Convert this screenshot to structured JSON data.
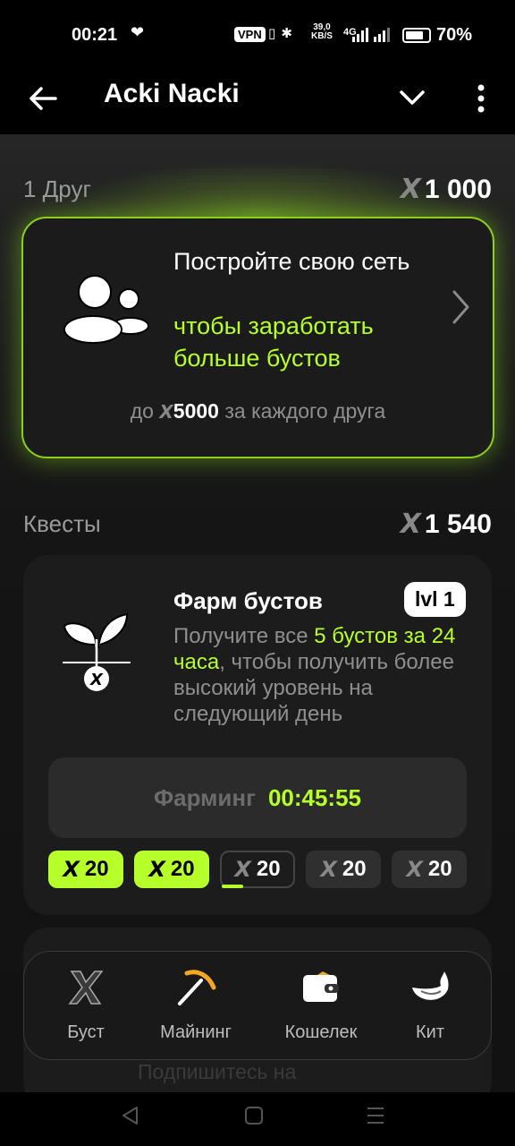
{
  "status_bar": {
    "time": "00:21",
    "vpn": "VPN",
    "net_speed_value": "39,0",
    "net_speed_unit": "KB/S",
    "signal": "4G",
    "battery": "70%"
  },
  "app_bar": {
    "title": "Acki Nacki"
  },
  "friends_section": {
    "label": "1 Друг",
    "amount": "1 000"
  },
  "friend_card": {
    "title": "Постройте свою сеть",
    "subtitle": "чтобы заработать больше бустов",
    "footer_prefix": "до",
    "footer_amount": "5000",
    "footer_suffix": "за каждого друга"
  },
  "quests_section": {
    "label": "Квесты",
    "amount": "1 540"
  },
  "quest": {
    "title": "Фарм бустов",
    "level": "lvl 1",
    "desc_part1": "Получите все ",
    "desc_highlight": "5 бустов за 24 часа",
    "desc_part2": ", чтобы получить более высокий уровень на следующий день",
    "farming_label": "Фарминг",
    "farming_time": "00:45:55",
    "boosts": [
      {
        "value": "20",
        "state": "collected"
      },
      {
        "value": "20",
        "state": "collected"
      },
      {
        "value": "20",
        "state": "current"
      },
      {
        "value": "20",
        "state": "locked"
      },
      {
        "value": "20",
        "state": "locked"
      }
    ]
  },
  "hidden_text": "Подпишитесь на",
  "tab_bar": {
    "items": [
      {
        "label": "Буст",
        "icon": "x-logo-icon"
      },
      {
        "label": "Майнинг",
        "icon": "pickaxe-icon"
      },
      {
        "label": "Кошелек",
        "icon": "wallet-icon"
      },
      {
        "label": "Кит",
        "icon": "whale-icon"
      }
    ]
  },
  "colors": {
    "accent": "#b7ff2a",
    "background": "#121212",
    "card": "#1c1c1c"
  }
}
